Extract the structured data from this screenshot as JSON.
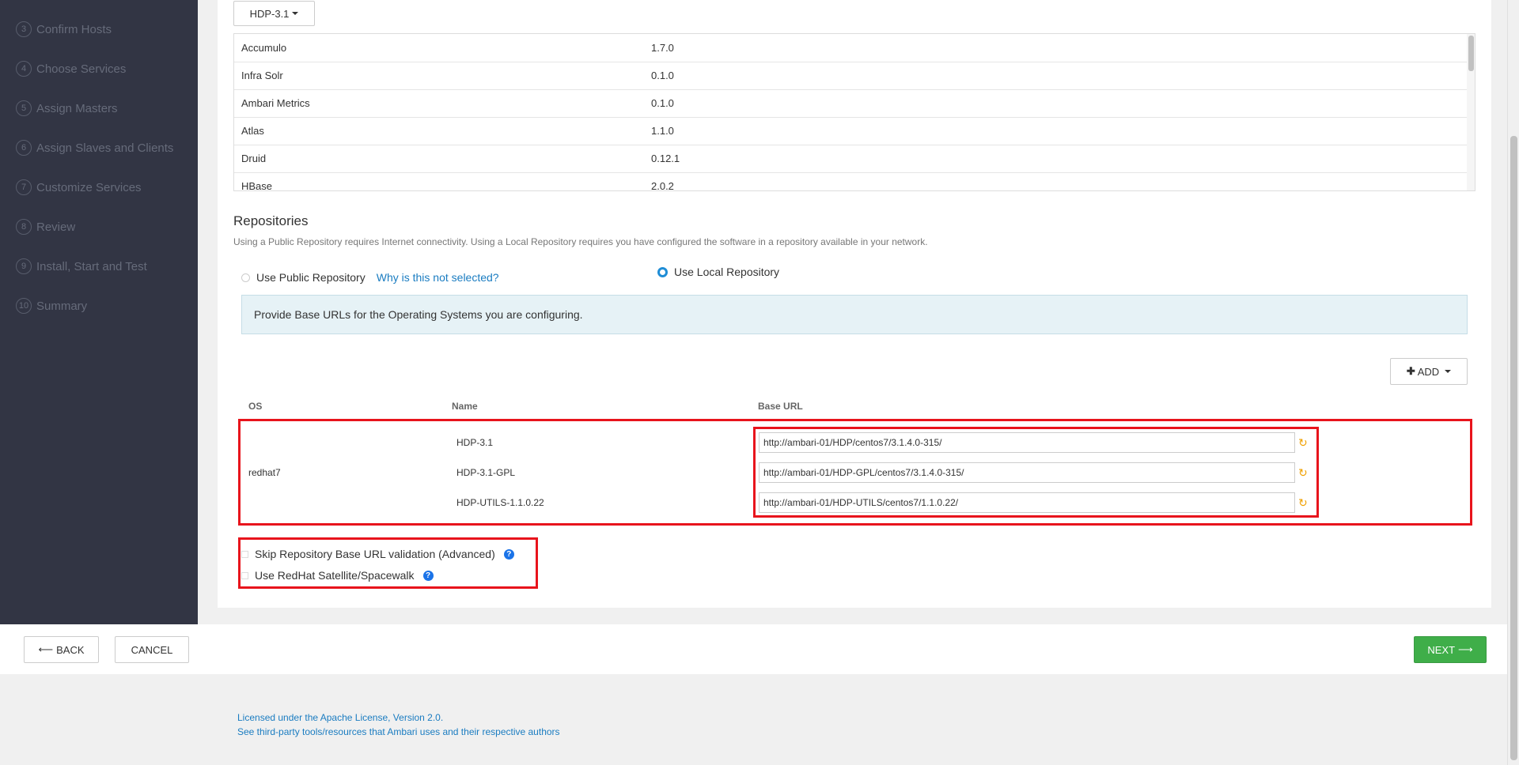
{
  "sidebar": {
    "steps": [
      {
        "num": "3",
        "label": "Confirm Hosts"
      },
      {
        "num": "4",
        "label": "Choose Services"
      },
      {
        "num": "5",
        "label": "Assign Masters"
      },
      {
        "num": "6",
        "label": "Assign Slaves and Clients"
      },
      {
        "num": "7",
        "label": "Customize Services"
      },
      {
        "num": "8",
        "label": "Review"
      },
      {
        "num": "9",
        "label": "Install, Start and Test"
      },
      {
        "num": "10",
        "label": "Summary"
      }
    ]
  },
  "stack": {
    "version_label": "HDP-3.1",
    "services": [
      {
        "name": "Accumulo",
        "version": "1.7.0"
      },
      {
        "name": "Infra Solr",
        "version": "0.1.0"
      },
      {
        "name": "Ambari Metrics",
        "version": "0.1.0"
      },
      {
        "name": "Atlas",
        "version": "1.1.0"
      },
      {
        "name": "Druid",
        "version": "0.12.1"
      },
      {
        "name": "HBase",
        "version": "2.0.2"
      }
    ]
  },
  "repositories": {
    "title": "Repositories",
    "description": "Using a Public Repository requires Internet connectivity. Using a Local Repository requires you have configured the software in a repository available in your network.",
    "public_label": "Use Public Repository",
    "why_link": "Why is this not selected?",
    "local_label": "Use Local Repository",
    "info": "Provide Base URLs for the Operating Systems you are configuring.",
    "add_label": "ADD",
    "columns": {
      "os": "OS",
      "name": "Name",
      "base_url": "Base URL"
    },
    "os": "redhat7",
    "repos": [
      {
        "name": "HDP-3.1",
        "url": "http://ambari-01/HDP/centos7/3.1.4.0-315/"
      },
      {
        "name": "HDP-3.1-GPL",
        "url": "http://ambari-01/HDP-GPL/centos7/3.1.4.0-315/"
      },
      {
        "name": "HDP-UTILS-1.1.0.22",
        "url": "http://ambari-01/HDP-UTILS/centos7/1.1.0.22/"
      }
    ],
    "skip_validation_label": "Skip Repository Base URL validation (Advanced)",
    "satellite_label": "Use RedHat Satellite/Spacewalk"
  },
  "footer": {
    "back_label": "BACK",
    "cancel_label": "CANCEL",
    "next_label": "NEXT",
    "license_link": "Licensed under the Apache License, Version 2.0.",
    "third_party_link": "See third-party tools/resources that Ambari uses and their respective authors"
  },
  "colors": {
    "sidebar_bg": "#323544",
    "accent": "#1f8dd6",
    "next_green": "#3fae49",
    "highlight_red": "#e8141c"
  }
}
